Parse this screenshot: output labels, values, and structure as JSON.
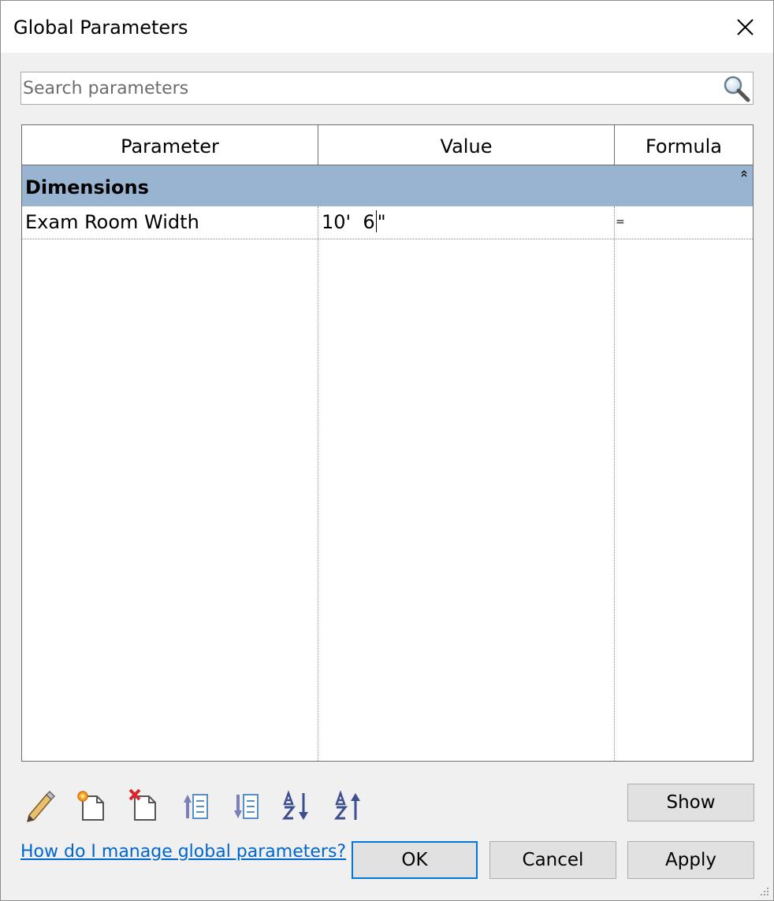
{
  "window": {
    "title": "Global Parameters"
  },
  "search": {
    "placeholder": "Search parameters",
    "value": ""
  },
  "grid": {
    "columns": [
      "Parameter",
      "Value",
      "Formula"
    ],
    "groups": [
      {
        "label": "Dimensions",
        "expanded": true,
        "rows": [
          {
            "parameter": "Exam Room Width",
            "value_before_caret": "10'  6",
            "value_after_caret": "\"",
            "formula": "="
          }
        ]
      }
    ]
  },
  "toolbar": {
    "icons": [
      "edit-parameter-icon",
      "new-parameter-icon",
      "delete-parameter-icon",
      "move-up-icon",
      "move-down-icon",
      "sort-ascending-icon",
      "sort-descending-icon"
    ]
  },
  "buttons": {
    "show": "Show",
    "ok": "OK",
    "cancel": "Cancel",
    "apply": "Apply"
  },
  "help": {
    "link_text": "How do I manage global parameters?"
  },
  "colors": {
    "group_header": "#99b4d1",
    "focus_border": "#0078d7",
    "link": "#0066cc"
  }
}
